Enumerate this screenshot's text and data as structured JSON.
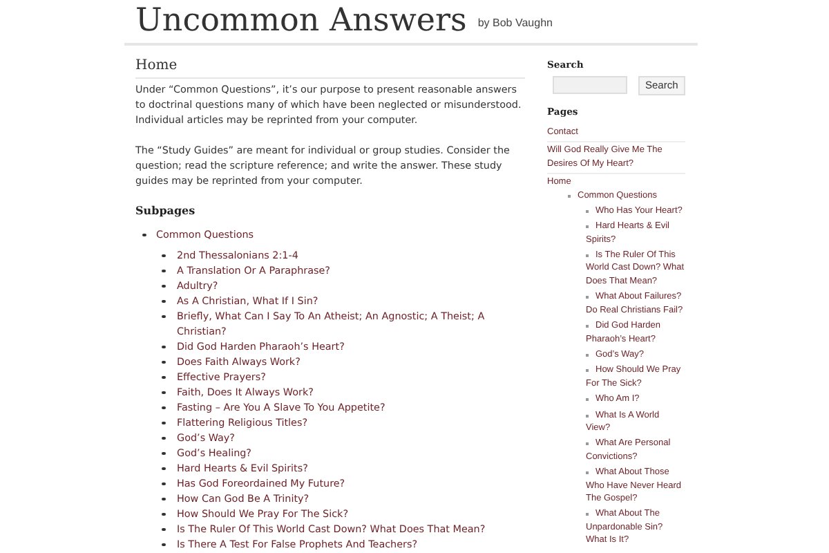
{
  "header": {
    "title": "Uncommon Answers",
    "byline": "by Bob Vaughn"
  },
  "main": {
    "title": "Home",
    "paragraphs": [
      "Under “Common Questions”, it’s our purpose to present reasonable answers to doctrinal questions many of which have been neglected or misunderstood. Individual articles may be reprinted from your computer.",
      "The “Study Guides” are meant for individual or group studies. Consider the question; read the scripture reference; and write the answer. These study guides may be reprinted from your computer."
    ],
    "subpages_heading": "Subpages",
    "subpages": [
      {
        "label": "Common Questions",
        "children": [
          {
            "label": "2nd Thessalonians 2:1-4"
          },
          {
            "label": "A Translation Or A Paraphrase?"
          },
          {
            "label": "Adultry?"
          },
          {
            "label": "As A Christian, What If I Sin?"
          },
          {
            "label": "Briefly, What Can I Say To An Atheist; An Agnostic; A Theist; A Christian?"
          },
          {
            "label": "Did God Harden Pharaoh’s Heart?"
          },
          {
            "label": "Does Faith Always Work?"
          },
          {
            "label": "Effective Prayers?"
          },
          {
            "label": "Faith, Does It Always Work?"
          },
          {
            "label": "Fasting – Are You A Slave To You Appetite?"
          },
          {
            "label": "Flattering Religious Titles?"
          },
          {
            "label": "God’s Way?"
          },
          {
            "label": "God’s Healing?"
          },
          {
            "label": "Hard Hearts & Evil Spirits?"
          },
          {
            "label": "Has God Foreordained My Future?"
          },
          {
            "label": "How Can God Be A Trinity?"
          },
          {
            "label": "How Should We Pray For The Sick?"
          },
          {
            "label": "Is The Ruler Of This World Cast Down? What Does That Mean?"
          },
          {
            "label": "Is There A Test For False Prophets And Teachers?"
          }
        ]
      }
    ]
  },
  "sidebar": {
    "search_heading": "Search",
    "search_button": "Search",
    "pages_heading": "Pages",
    "pages": [
      {
        "label": "Contact"
      },
      {
        "label": "Will God Really Give Me The Desires Of My Heart?"
      },
      {
        "label": "Home",
        "children": [
          {
            "label": "Common Questions",
            "children": [
              {
                "label": "Who Has Your Heart?"
              },
              {
                "label": "Hard Hearts & Evil Spirits?"
              },
              {
                "label": "Is The Ruler Of This World Cast Down? What Does That Mean?"
              },
              {
                "label": "What About Failures? Do Real Christians Fail?"
              },
              {
                "label": "Did God Harden Pharaoh’s Heart?"
              },
              {
                "label": "God’s Way?"
              },
              {
                "label": "How Should We Pray For The Sick?"
              },
              {
                "label": "Who Am I?"
              },
              {
                "label": "What Is A World View?"
              },
              {
                "label": "What Are Personal Convictions?"
              },
              {
                "label": "What About Those Who Have Never Heard The Gospel?"
              },
              {
                "label": "What About The Unpardonable Sin? What Is It?"
              }
            ]
          }
        ]
      }
    ]
  }
}
